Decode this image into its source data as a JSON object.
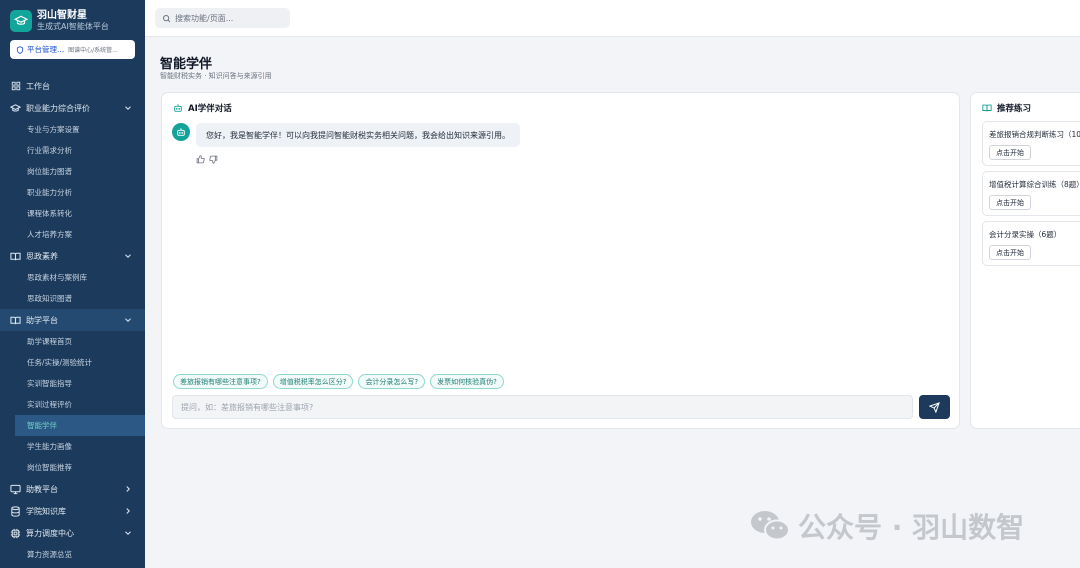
{
  "brand": {
    "name": "羽山智财星",
    "subtitle": "生成式AI智能体平台"
  },
  "workspace": {
    "name": "平台管理...",
    "path": "图谱中心/系统管..."
  },
  "nav": [
    {
      "label": "工作台",
      "icon": "dashboard-icon",
      "type": "item"
    },
    {
      "label": "职业能力综合评价",
      "icon": "graduation-cap-icon",
      "type": "group",
      "expanded": true,
      "children": [
        "专业与方案设置",
        "行业需求分析",
        "岗位能力图谱",
        "职业能力分析",
        "课程体系转化",
        "人才培养方案"
      ]
    },
    {
      "label": "思政素养",
      "icon": "book-open-icon",
      "type": "group",
      "expanded": true,
      "children": [
        "思政素材与案例库",
        "思政知识图谱"
      ]
    },
    {
      "label": "助学平台",
      "icon": "book-open-icon",
      "type": "group",
      "expanded": true,
      "highlighted": true,
      "children": [
        "助学课程首页",
        "任务/实操/测验统计",
        "实训智能指导",
        "实训过程评价",
        "智能学伴",
        "学生能力画像",
        "岗位智能推荐"
      ],
      "active_child": "智能学伴"
    },
    {
      "label": "助教平台",
      "icon": "monitor-icon",
      "type": "group",
      "expanded": false
    },
    {
      "label": "学院知识库",
      "icon": "database-icon",
      "type": "group",
      "expanded": false
    },
    {
      "label": "算力调度中心",
      "icon": "cpu-icon",
      "type": "group",
      "expanded": true,
      "children": [
        "算力资源总览"
      ]
    }
  ],
  "search": {
    "placeholder": "搜索功能/页面..."
  },
  "page": {
    "title": "智能学伴",
    "subtitle": "智能财税实务 · 知识问答与来源引用"
  },
  "chat": {
    "title": "AI学伴对话",
    "message": "您好，我是智能学伴！可以向我提问智能财税实务相关问题，我会给出知识来源引用。",
    "suggestions": [
      "差旅报销有哪些注意事项?",
      "增值税税率怎么区分?",
      "会计分录怎么写?",
      "发票如何核验真伪?"
    ],
    "input_placeholder": "提问，如：差旅报销有哪些注意事项?"
  },
  "practice": {
    "title": "推荐练习",
    "items": [
      {
        "name": "差旅报销合规判断练习（10",
        "button": "点击开始"
      },
      {
        "name": "增值税计算综合训练（8题）",
        "button": "点击开始"
      },
      {
        "name": "会计分录实操（6题）",
        "button": "点击开始"
      }
    ]
  },
  "watermark": {
    "text": "公众号 · 羽山数智"
  },
  "colors": {
    "sidebar": "#1c3a5b",
    "accent": "#14a39a",
    "send": "#1d3a5c",
    "active_text": "#6fd3c8"
  }
}
